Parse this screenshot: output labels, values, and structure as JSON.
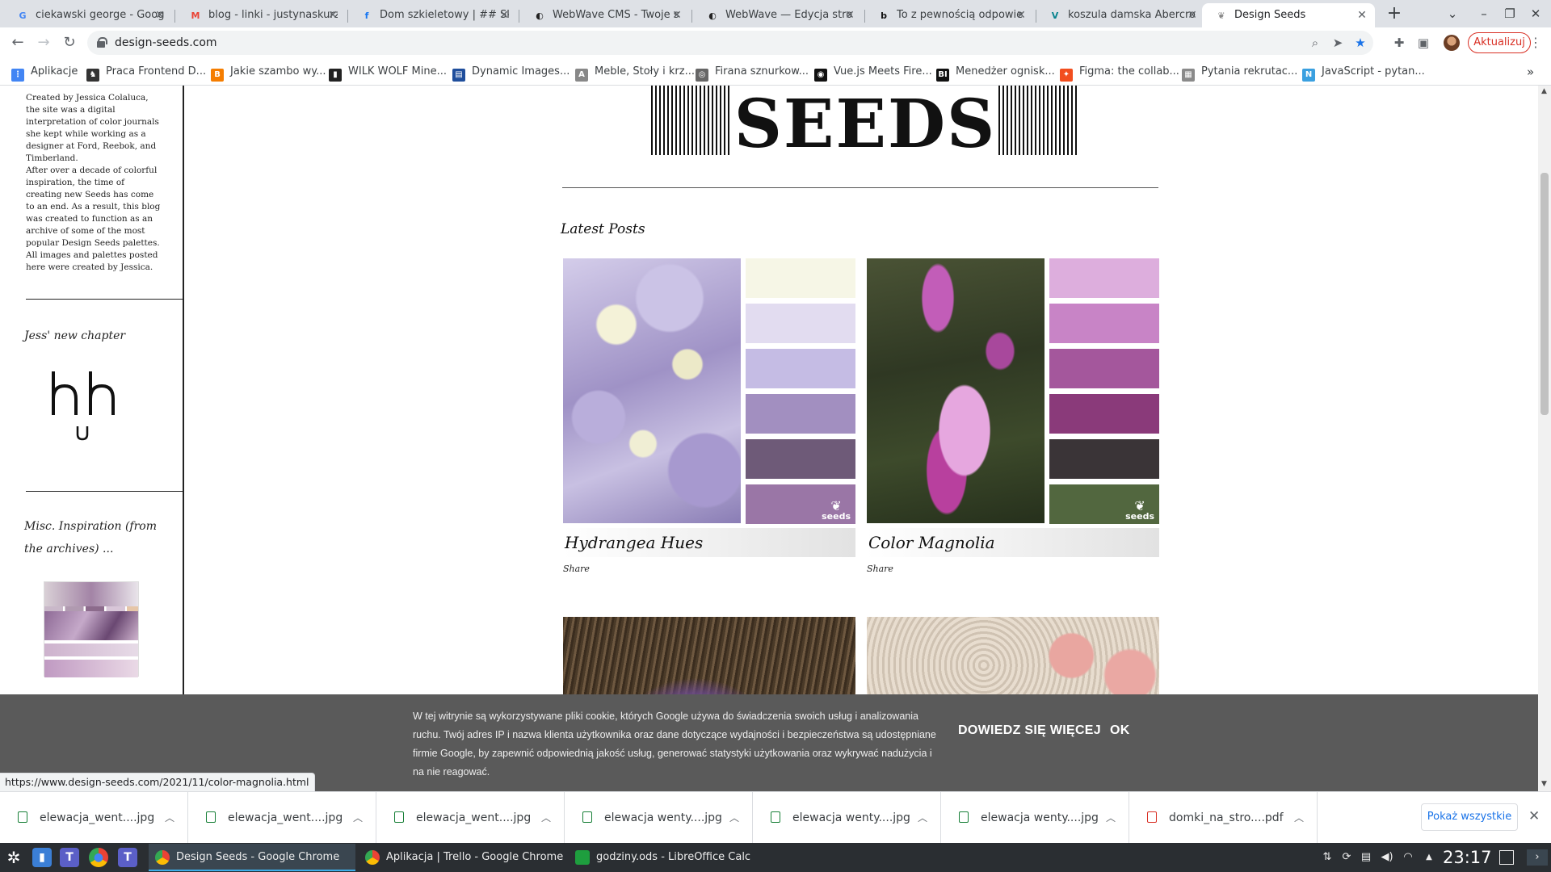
{
  "browser": {
    "tabs": [
      {
        "title": "ciekawski george - Goog",
        "icon": "google-icon",
        "color": "#4285f4",
        "glyph": "G"
      },
      {
        "title": "blog - linki - justynaskurz",
        "icon": "gmail-icon",
        "color": "#ea4335",
        "glyph": "M"
      },
      {
        "title": "Dom szkieletowy | ## Sk",
        "icon": "facebook-icon",
        "color": "#1877f2",
        "glyph": "f"
      },
      {
        "title": "WebWave CMS - Twoje s",
        "icon": "webwave-icon",
        "color": "#222222",
        "glyph": "◐"
      },
      {
        "title": "WebWave — Edycja stro",
        "icon": "webwave-icon",
        "color": "#222222",
        "glyph": "◐"
      },
      {
        "title": "To z pewnością odpowie",
        "icon": "brainly-icon",
        "color": "#111111",
        "glyph": "b"
      },
      {
        "title": "koszula damska Abercro",
        "icon": "vinted-icon",
        "color": "#09838e",
        "glyph": "V"
      },
      {
        "title": "Design Seeds",
        "icon": "leaf-icon",
        "color": "#888888",
        "glyph": "❦",
        "active": true
      }
    ],
    "url": "design-seeds.com",
    "update_label": "Aktualizuj",
    "bookmarks": [
      {
        "label": "Aplikacje",
        "icon": "apps-grid-icon",
        "color": "#4285f4",
        "glyph": "⋮"
      },
      {
        "label": "Praca Frontend D...",
        "icon": "horse-icon",
        "color": "#333333",
        "glyph": "♞"
      },
      {
        "label": "Jakie szambo wy...",
        "icon": "blogger-icon",
        "color": "#f57d00",
        "glyph": "B"
      },
      {
        "label": "WILK WOLF Mine...",
        "icon": "bookmark-icon",
        "color": "#222222",
        "glyph": "▮"
      },
      {
        "label": "Dynamic Images...",
        "icon": "image-icon",
        "color": "#1f4e9c",
        "glyph": "▤"
      },
      {
        "label": "Meble, Stoły i krz...",
        "icon": "acme-icon",
        "color": "#888888",
        "glyph": "A"
      },
      {
        "label": "Firana sznurkow...",
        "icon": "globe-icon",
        "color": "#666666",
        "glyph": "◎"
      },
      {
        "label": "Vue.js Meets Fire...",
        "icon": "dev-icon",
        "color": "#111111",
        "glyph": "◉"
      },
      {
        "label": "Menedżer ognisk...",
        "icon": "bi-icon",
        "color": "#111111",
        "glyph": "BI"
      },
      {
        "label": "Figma: the collab...",
        "icon": "figma-icon",
        "color": "#f24e1e",
        "glyph": "✦"
      },
      {
        "label": "Pytania rekrutac...",
        "icon": "page-icon",
        "color": "#8a8a8a",
        "glyph": "▦"
      },
      {
        "label": "JavaScript - pytan...",
        "icon": "net-icon",
        "color": "#3aa0e0",
        "glyph": "N"
      }
    ]
  },
  "sidebar": {
    "about_p1": "Created by Jessica Colaluca, the site was a digital interpretation of color journals she kept while working as a designer at Ford, Reebok, and Timberland.",
    "about_p2": "After over a decade of colorful inspiration, the time of creating new Seeds has come to an end. As a result, this blog was created to function as an archive of some of the most popular Design Seeds palettes. All images and palettes posted here were created by Jessica.",
    "new_chapter_title": "Jess' new chapter",
    "misc_title": "Misc. Inspiration (from the archives) ..."
  },
  "main": {
    "logo_text": "SEEDS",
    "latest_title": "Latest Posts",
    "posts": [
      {
        "title": "Hydrangea Hues",
        "share": "Share",
        "mark": "seeds",
        "swatches": [
          "#f6f6e6",
          "#e2dcf0",
          "#c5bce4",
          "#a28fc0",
          "#6e5a78",
          "#9a76a6"
        ]
      },
      {
        "title": "Color Magnolia",
        "share": "Share",
        "mark": "seeds",
        "swatches": [
          "#ddaedd",
          "#c884c6",
          "#a4579c",
          "#8a3a7a",
          "#3a3437",
          "#52673f"
        ]
      }
    ]
  },
  "cookie": {
    "text": "W tej witrynie są wykorzystywane pliki cookie, których Google używa do świadczenia swoich usług i analizowania ruchu. Twój adres IP i nazwa klienta użytkownika oraz dane dotyczące wydajności i bezpieczeństwa są udostępniane firmie Google, by zapewnić odpowiednią jakość usług, generować statystyki użytkowania oraz wykrywać nadużycia i na nie reagować.",
    "learn_more": "DOWIEDZ SIĘ WIĘCEJ",
    "ok": "OK"
  },
  "status_url": "https://www.design-seeds.com/2021/11/color-magnolia.html",
  "downloads": {
    "items": [
      {
        "name": "elewacja_went....jpg",
        "type": "image"
      },
      {
        "name": "elewacja_went....jpg",
        "type": "image"
      },
      {
        "name": "elewacja_went....jpg",
        "type": "image"
      },
      {
        "name": "elewacja wenty....jpg",
        "type": "image"
      },
      {
        "name": "elewacja wenty....jpg",
        "type": "image"
      },
      {
        "name": "elewacja wenty....jpg",
        "type": "image"
      },
      {
        "name": "domki_na_stro....pdf",
        "type": "pdf"
      }
    ],
    "show_all": "Pokaż wszystkie"
  },
  "taskbar": {
    "tasks": [
      {
        "label": "Design Seeds - Google Chrome",
        "active": true
      },
      {
        "label": "Aplikacja | Trello - Google Chrome",
        "active": false
      },
      {
        "label": "godziny.ods - LibreOffice Calc",
        "active": false
      }
    ],
    "clock": "23:17"
  }
}
